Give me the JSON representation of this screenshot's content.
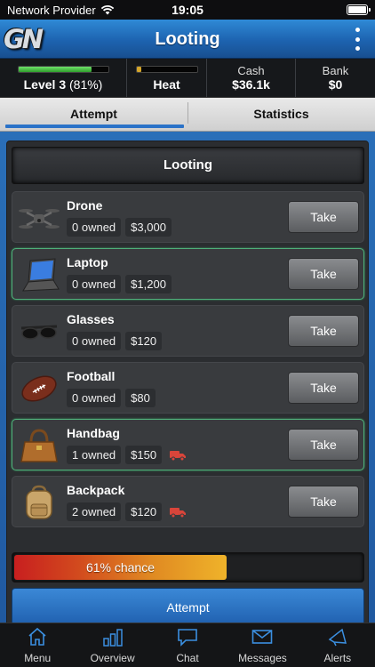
{
  "status_bar": {
    "carrier": "Network Provider",
    "time": "19:05"
  },
  "header": {
    "logo_text": "GN",
    "title": "Looting"
  },
  "stats": {
    "level": {
      "label": "Level 3",
      "percent_text": "(81%)",
      "progress": 0.81
    },
    "heat": {
      "label": "Heat",
      "progress": 0.08
    },
    "cash": {
      "label": "Cash",
      "value": "$36.1k"
    },
    "bank": {
      "label": "Bank",
      "value": "$0"
    }
  },
  "tabs": [
    {
      "label": "Attempt",
      "active": true
    },
    {
      "label": "Statistics",
      "active": false
    }
  ],
  "panel": {
    "title": "Looting"
  },
  "items": [
    {
      "name": "Drone",
      "owned": "0 owned",
      "price": "$3,000",
      "button": "Take",
      "highlighted": false,
      "truck": false,
      "icon": "drone-icon"
    },
    {
      "name": "Laptop",
      "owned": "0 owned",
      "price": "$1,200",
      "button": "Take",
      "highlighted": true,
      "truck": false,
      "icon": "laptop-icon"
    },
    {
      "name": "Glasses",
      "owned": "0 owned",
      "price": "$120",
      "button": "Take",
      "highlighted": false,
      "truck": false,
      "icon": "glasses-icon"
    },
    {
      "name": "Football",
      "owned": "0 owned",
      "price": "$80",
      "button": "Take",
      "highlighted": false,
      "truck": false,
      "icon": "football-icon"
    },
    {
      "name": "Handbag",
      "owned": "1 owned",
      "price": "$150",
      "button": "Take",
      "highlighted": true,
      "truck": true,
      "icon": "handbag-icon"
    },
    {
      "name": "Backpack",
      "owned": "2 owned",
      "price": "$120",
      "button": "Take",
      "highlighted": false,
      "truck": true,
      "icon": "backpack-icon"
    }
  ],
  "chance": {
    "text": "61% chance",
    "value": 0.61
  },
  "attempt_button": "Attempt",
  "bottom_nav": [
    {
      "label": "Menu",
      "icon": "home-icon"
    },
    {
      "label": "Overview",
      "icon": "bar-chart-icon"
    },
    {
      "label": "Chat",
      "icon": "chat-bubble-icon"
    },
    {
      "label": "Messages",
      "icon": "envelope-icon"
    },
    {
      "label": "Alerts",
      "icon": "megaphone-icon"
    }
  ],
  "colors": {
    "accent": "#2a72c8",
    "truck": "#d9453a",
    "highlight_border": "#4fb07a"
  }
}
